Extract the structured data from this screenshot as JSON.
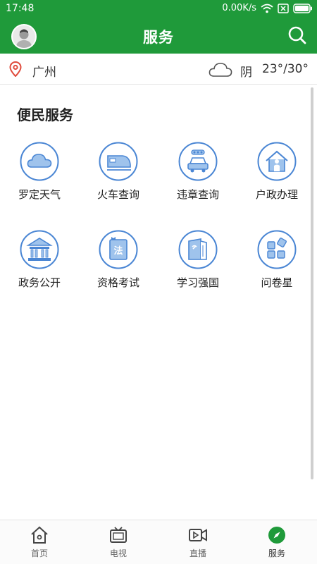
{
  "status_bar": {
    "time": "17:48",
    "network_speed": "0.00K/s"
  },
  "header": {
    "title": "服务"
  },
  "location": {
    "city": "广州",
    "weather": "阴",
    "temperature": "23°/30°"
  },
  "section": {
    "title": "便民服务"
  },
  "services": [
    {
      "label": "罗定天气",
      "icon": "cloud-icon"
    },
    {
      "label": "火车查询",
      "icon": "train-icon"
    },
    {
      "label": "违章查询",
      "icon": "car-icon"
    },
    {
      "label": "户政办理",
      "icon": "house-person-icon"
    },
    {
      "label": "政务公开",
      "icon": "government-building-icon"
    },
    {
      "label": "资格考试",
      "icon": "law-book-icon"
    },
    {
      "label": "学习强国",
      "icon": "party-book-icon"
    },
    {
      "label": "问卷星",
      "icon": "grid-squares-icon"
    }
  ],
  "tabs": [
    {
      "label": "首页",
      "icon": "home-icon"
    },
    {
      "label": "电视",
      "icon": "tv-icon"
    },
    {
      "label": "直播",
      "icon": "live-video-icon"
    },
    {
      "label": "服务",
      "icon": "compass-icon",
      "active": true
    }
  ],
  "colors": {
    "brand_green": "#1f9a3a",
    "icon_blue": "#4a86d4",
    "icon_fill": "#9fc3ec"
  }
}
